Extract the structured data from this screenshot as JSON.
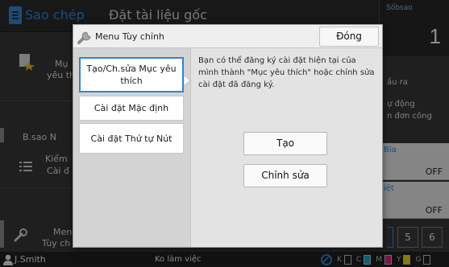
{
  "background": {
    "title": "Sao chép",
    "subtitle": "Đặt tài liệu gốc",
    "copies": {
      "label": "Sốbsao",
      "value": "1"
    },
    "left_items": [
      {
        "line1": "Mụ",
        "line2": "yêu th"
      },
      {
        "line1": "B.sao N",
        "line2": ""
      },
      {
        "line1": "Kiểm",
        "line2": "Cài đ"
      },
      {
        "line1": "Men",
        "line2": "Tùy ch"
      }
    ],
    "right_texts": [
      "ầu ra",
      "ự động",
      "n đơn công"
    ],
    "tiles": [
      {
        "label": "Bìa",
        "value": "OFF"
      },
      {
        "label": "iệt",
        "value": "OFF"
      }
    ],
    "num_buttons": [
      "5",
      "6"
    ],
    "status": {
      "user": "J.Smith",
      "state": "Ko làm việc",
      "inks": [
        "K",
        "C",
        "M",
        "Y",
        "G"
      ]
    }
  },
  "modal": {
    "title": "Menu Tùy chỉnh",
    "close_label": "Đóng",
    "menu": [
      {
        "label": "Tạo/Ch.sửa Mục yêu thích"
      },
      {
        "label": "Cài đặt Mặc định"
      },
      {
        "label": "Cài đặt Thứ tự Nút"
      }
    ],
    "description": "Bạn có thể đăng ký cài đặt hiện tại của mình thành \"Mục yêu thích\" hoặc chỉnh sửa cài đặt đã đăng ký.",
    "buttons": {
      "create": "Tạo",
      "edit": "Chỉnh sửa"
    }
  },
  "colors": {
    "accent": "#2f84d6",
    "ink_c": "#1aa3d8",
    "ink_m": "#d6247a",
    "ink_y": "#e7d21c"
  }
}
